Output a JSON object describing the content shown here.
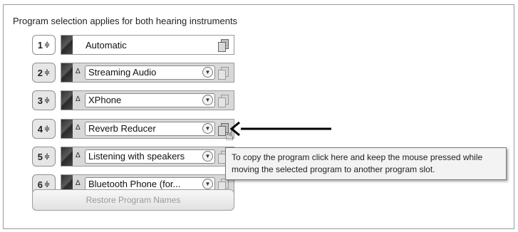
{
  "heading": "Program selection applies for both hearing instruments",
  "programs": [
    {
      "slot": "1",
      "name": "Automatic"
    },
    {
      "slot": "2",
      "name": "Streaming Audio"
    },
    {
      "slot": "3",
      "name": "XPhone"
    },
    {
      "slot": "4",
      "name": "Reverb Reducer"
    },
    {
      "slot": "5",
      "name": "Listening with speakers"
    },
    {
      "slot": "6",
      "name": "Bluetooth Phone (for..."
    }
  ],
  "symbols": {
    "updown": "≑",
    "delta": "Δ",
    "dropdown": "▼",
    "cursor": "☝"
  },
  "restore_label": "Restore Program Names",
  "tooltip": "To copy the program click here and keep the mouse pressed while moving the selected program to another program slot."
}
